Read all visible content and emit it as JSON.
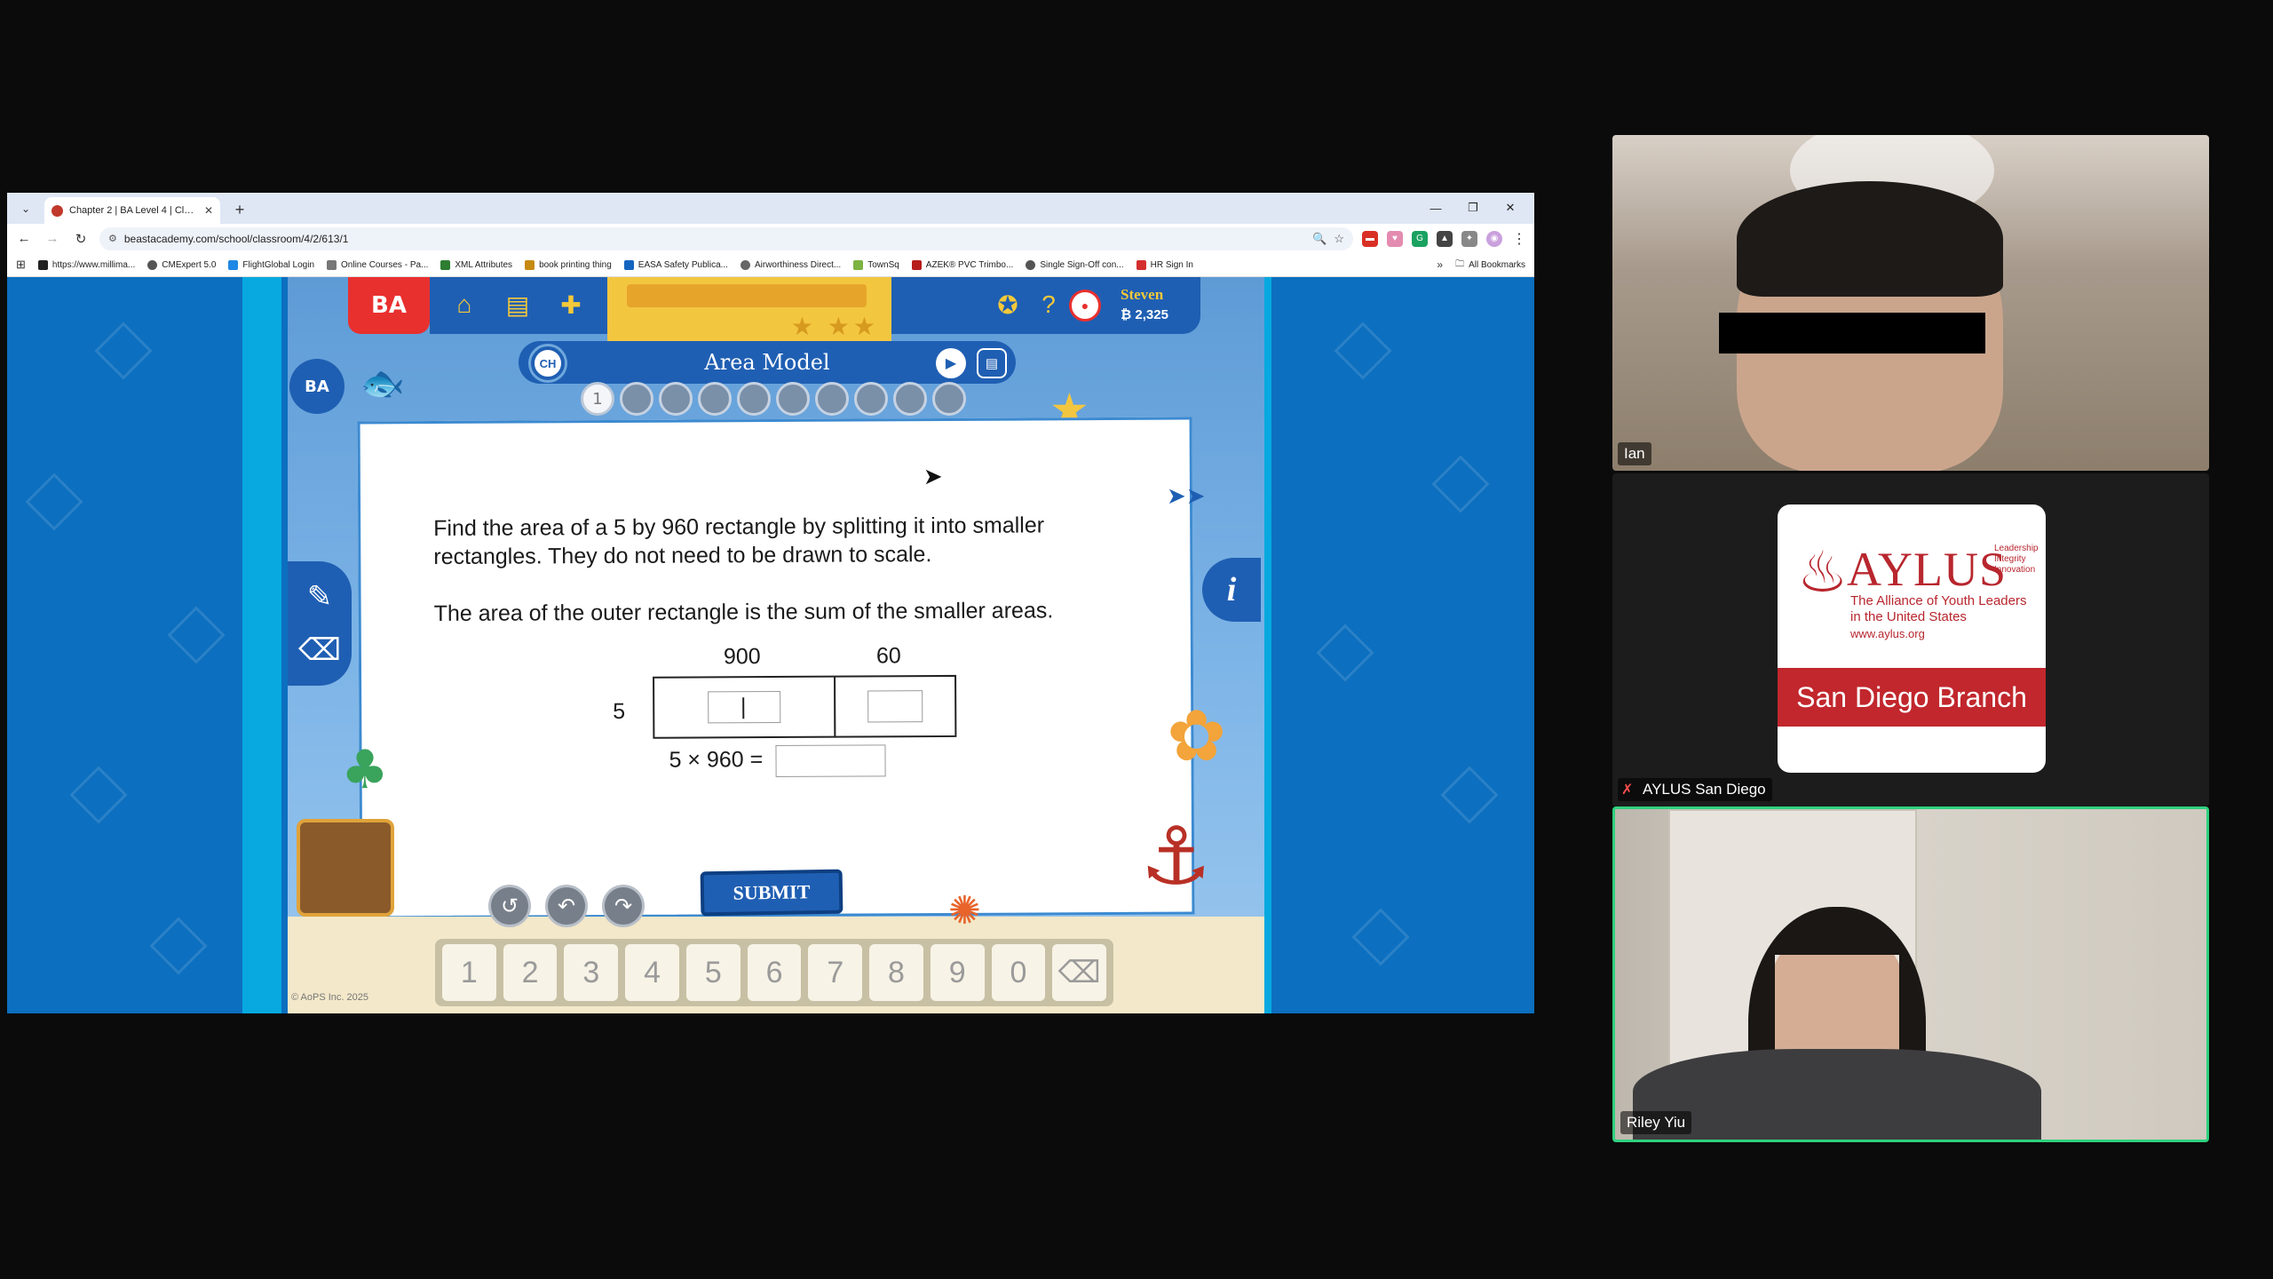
{
  "browser": {
    "tab_title": "Chapter 2 | BA Level 4 | Classro",
    "url": "beastacademy.com/school/classroom/4/2/613/1",
    "bookmarks": [
      "https://www.millima...",
      "CMExpert 5.0",
      "FlightGlobal Login",
      "Online Courses - Pa...",
      "XML Attributes",
      "book printing thing",
      "EASA Safety Publica...",
      "Airworthiness Direct...",
      "TownSq",
      "AZEK® PVC Trimbo...",
      "Single Sign-Off con...",
      "HR Sign In"
    ],
    "all_bookmarks": "All Bookmarks",
    "overflow": "»"
  },
  "game": {
    "logo": "BA",
    "user_name": "Steven",
    "coins": "₿ 2,325",
    "chapter_badge": "CH",
    "lesson_title": "Area Model",
    "problem_numbers": [
      "1",
      "",
      "",
      "",
      "",
      "",
      "",
      "",
      "",
      ""
    ],
    "problem_lines": [
      "Find the area of a 5 by 960 rectangle by splitting it into smaller",
      "rectangles. They do not need to be drawn to scale."
    ],
    "hint_line": "The area of the outer rectangle is the sum of the smaller areas.",
    "col_labels": [
      "900",
      "60"
    ],
    "row_label": "5",
    "equation": "5 × 960 =",
    "submit": "SUBMIT",
    "keys": [
      "1",
      "2",
      "3",
      "4",
      "5",
      "6",
      "7",
      "8",
      "9",
      "0",
      "⌫"
    ],
    "copyright": "© AoPS Inc. 2025"
  },
  "participants": {
    "ian": "Ian",
    "aylus": "AYLUS San Diego",
    "riley": "Riley Yiu"
  },
  "aylus_card": {
    "name": "AYLUS",
    "tagline": [
      "Leadership",
      "Integrity",
      "Innovation"
    ],
    "subtitle": "The Alliance of Youth Leaders in the United States",
    "website": "www.aylus.org",
    "branch": "San Diego Branch"
  },
  "colors": {
    "brand_red": "#e8302f",
    "game_blue": "#1f5fb3",
    "aylus_red": "#c1272d",
    "active_speaker": "#2fd17e"
  }
}
